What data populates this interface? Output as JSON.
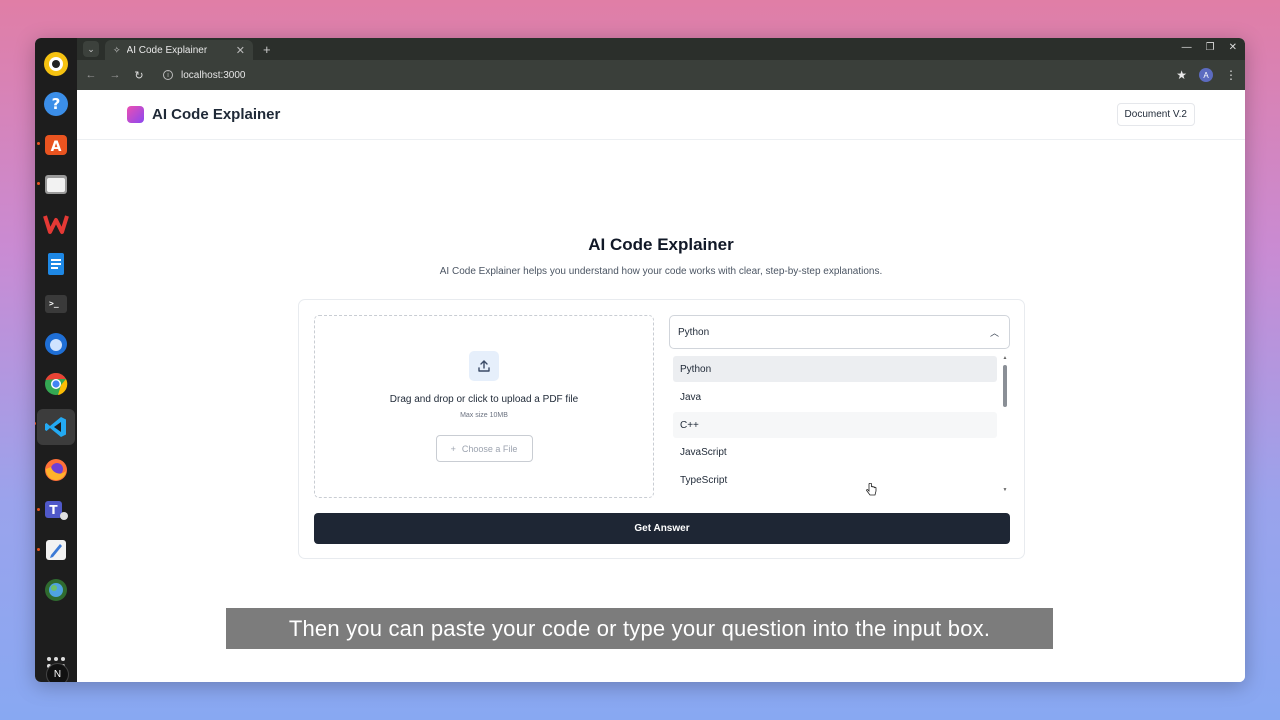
{
  "browser": {
    "tab_title": "AI Code Explainer",
    "url": "localhost:3000",
    "profile_initial": "A"
  },
  "app": {
    "brand_name": "AI Code Explainer",
    "doc_button": "Document V.2",
    "hero_title": "AI Code Explainer",
    "hero_subtitle": "AI Code Explainer helps you understand how your code works with clear, step-by-step explanations."
  },
  "upload": {
    "prompt": "Drag and drop or click to upload a PDF file",
    "max_size": "Max size 10MB",
    "choose_button": "Choose a File"
  },
  "language_select": {
    "selected": "Python",
    "options": [
      "Python",
      "Java",
      "C++",
      "JavaScript",
      "TypeScript"
    ],
    "selected_index": 0,
    "hover_index": 2
  },
  "submit": {
    "label": "Get Answer"
  },
  "caption": "Then you can paste your code or type your question into the input box.",
  "next_badge": "N",
  "colors": {
    "brand_gradient_start": "#ec4fb2",
    "brand_gradient_end": "#8b48f0",
    "button_dark": "#1e2634"
  }
}
